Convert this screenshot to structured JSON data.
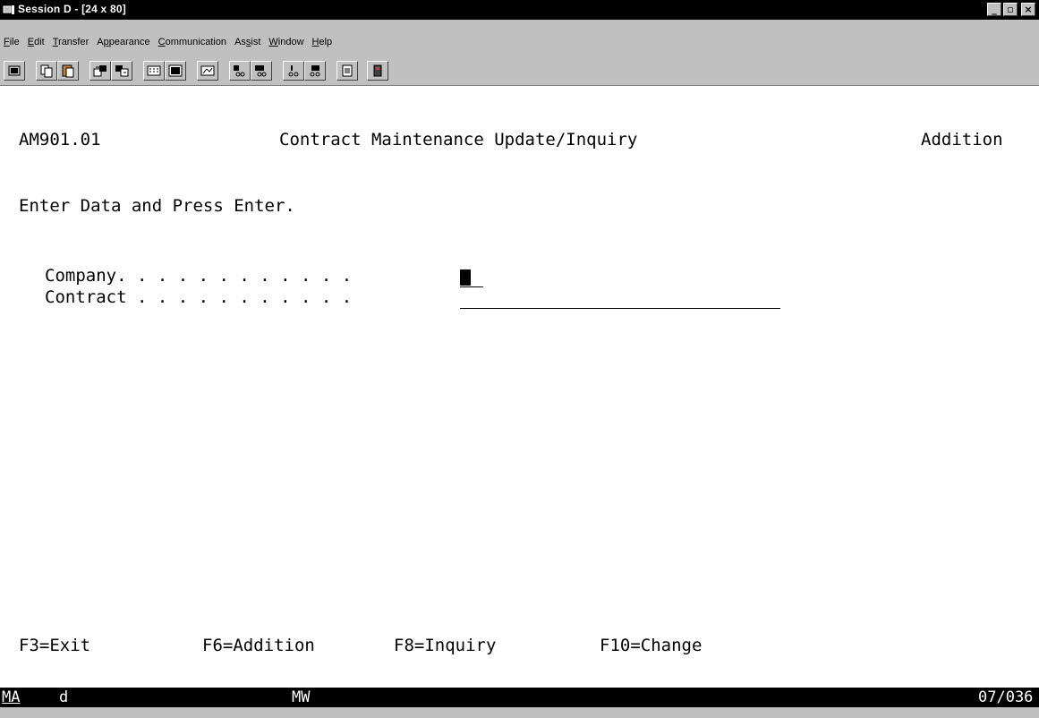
{
  "window": {
    "title": "Session D - [24 x 80]",
    "controls": {
      "minimize": "_",
      "maximize": "▫",
      "close": "×"
    }
  },
  "menu": [
    {
      "label": "File",
      "accel": "F"
    },
    {
      "label": "Edit",
      "accel": "E"
    },
    {
      "label": "Transfer",
      "accel": "T"
    },
    {
      "label": "Appearance",
      "accel": "p"
    },
    {
      "label": "Communication",
      "accel": "C"
    },
    {
      "label": "Assist",
      "accel": "s"
    },
    {
      "label": "Window",
      "accel": "W"
    },
    {
      "label": "Help",
      "accel": "H"
    }
  ],
  "toolbar": {
    "buttons": [
      "print-screen-icon",
      "copy-icon",
      "paste-icon",
      "send-file-icon",
      "receive-file-icon",
      "keypad-icon",
      "display-icon",
      "macro-icon",
      "play-macro-icon",
      "record-macro-icon",
      "stop-macro-icon",
      "pause-macro-icon",
      "clipboard-icon",
      "exit-icon"
    ]
  },
  "screen": {
    "program_id": "AM901.01",
    "title": "Contract Maintenance Update/Inquiry",
    "mode": "Addition",
    "instruction": "Enter Data and Press Enter.",
    "fields": [
      {
        "label": "Company. . . . . . . . . . . .",
        "value": ""
      },
      {
        "label": "Contract . . . . . . . . . . .",
        "value": ""
      }
    ],
    "function_keys": [
      "F3=Exit",
      "F6=Addition",
      "F8=Inquiry",
      "F10=Change"
    ]
  },
  "status": {
    "indicator_left": "MA",
    "session": "d",
    "mode": "MW",
    "cursor_pos": "07/036"
  },
  "colors": {
    "titlebar": "#000000",
    "chrome": "#c0c0c0",
    "screen_bg": "#ffffff",
    "screen_text": "#000000"
  }
}
